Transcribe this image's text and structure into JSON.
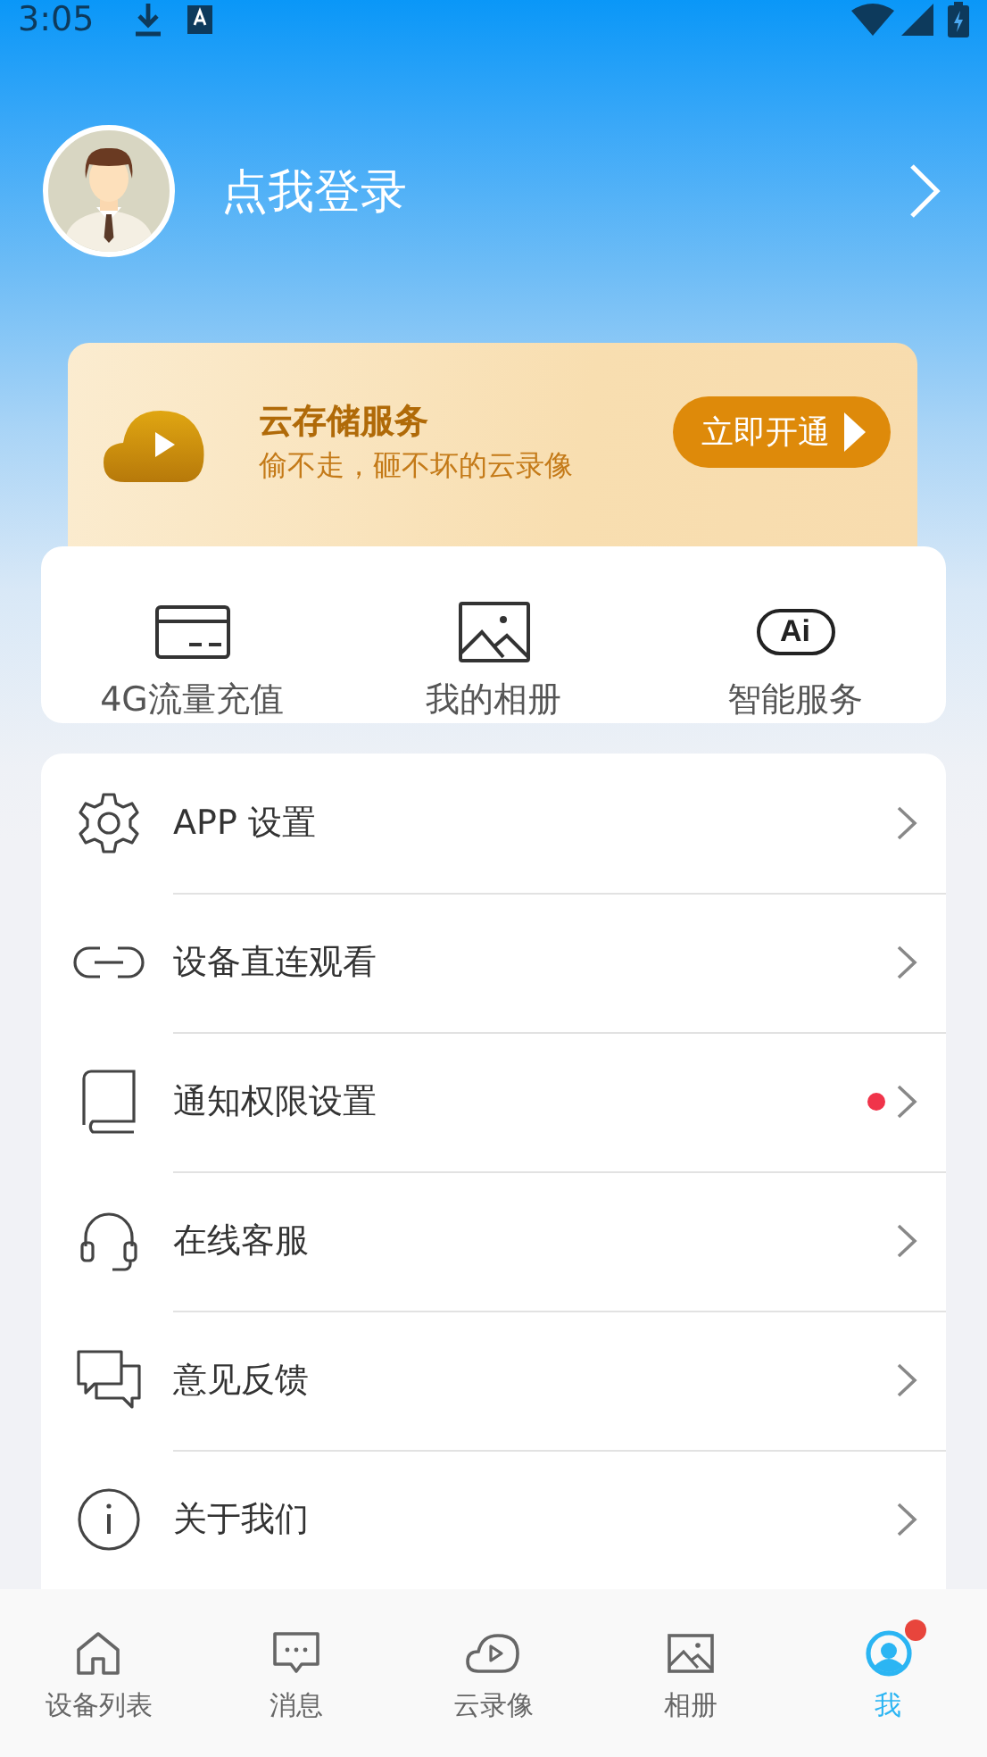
{
  "status_bar": {
    "time": "3:05"
  },
  "profile": {
    "login_label": "点我登录"
  },
  "cloud_banner": {
    "title": "云存储服务",
    "subtitle": "偷不走，砸不坏的云录像",
    "button": "立即开通"
  },
  "quick_actions": [
    {
      "label": "4G流量充值"
    },
    {
      "label": "我的相册"
    },
    {
      "label": "智能服务",
      "icon_text": "Ai"
    }
  ],
  "menu": [
    {
      "label": "APP 设置",
      "badge": false
    },
    {
      "label": "设备直连观看",
      "badge": false
    },
    {
      "label": "通知权限设置",
      "badge": true
    },
    {
      "label": "在线客服",
      "badge": false
    },
    {
      "label": "意见反馈",
      "badge": false
    },
    {
      "label": "关于我们",
      "badge": false
    }
  ],
  "tab_bar": [
    {
      "label": "设备列表",
      "selected": false,
      "badge": false
    },
    {
      "label": "消息",
      "selected": false,
      "badge": false
    },
    {
      "label": "云录像",
      "selected": false,
      "badge": false
    },
    {
      "label": "相册",
      "selected": false,
      "badge": false
    },
    {
      "label": "我",
      "selected": true,
      "badge": true
    }
  ]
}
